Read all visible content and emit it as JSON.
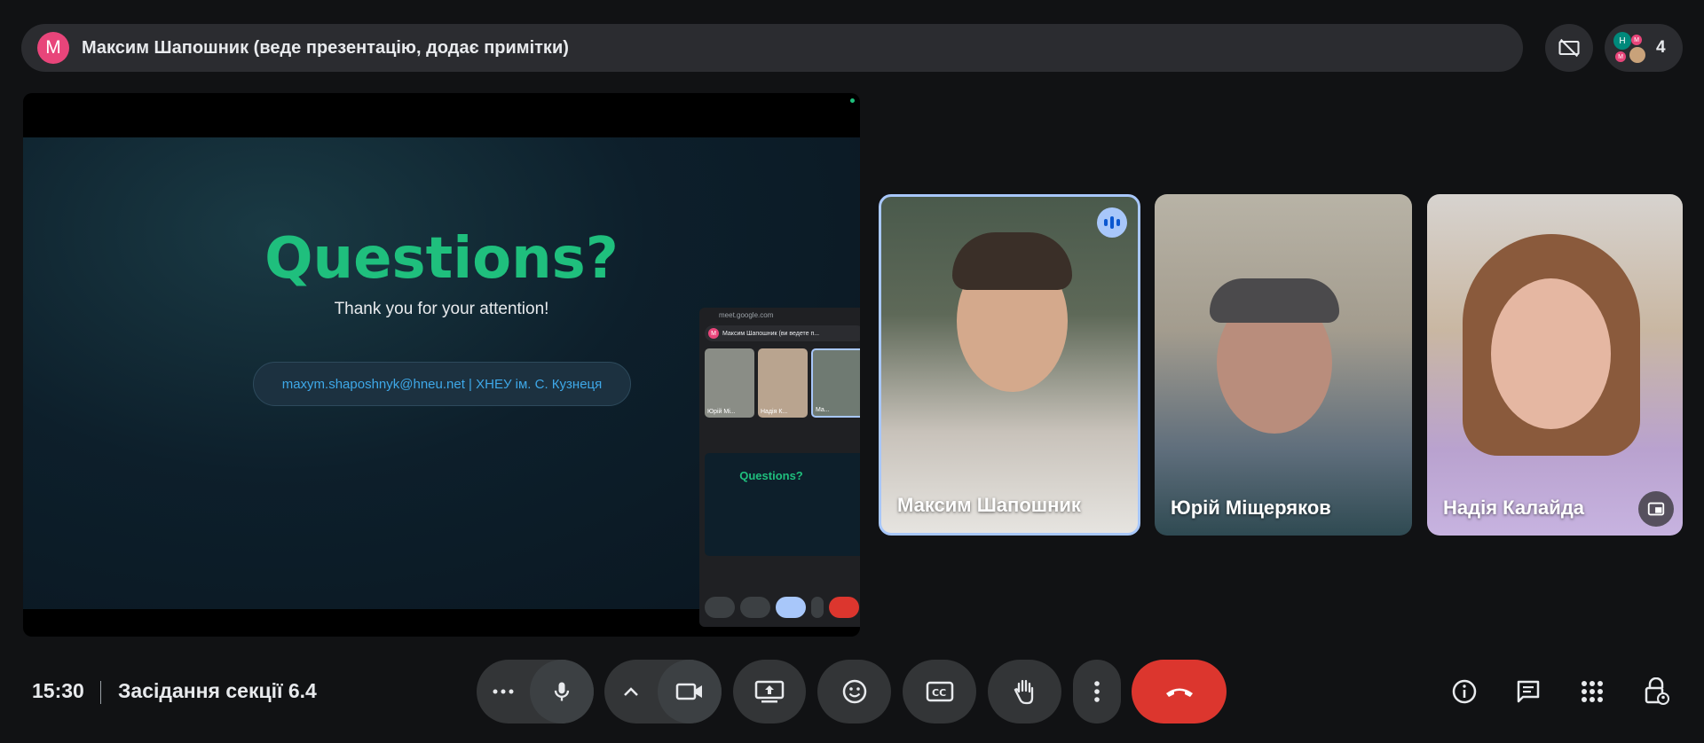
{
  "topbar": {
    "presenter_initial": "M",
    "presenter_title": "Максим Шапошник (веде презентацію, додає примітки)",
    "participant_count": "4",
    "mini_avatars": [
      "H",
      "M",
      "M"
    ]
  },
  "slide": {
    "title": "Questions?",
    "subtitle": "Thank you for your attention!",
    "contact": "maxym.shaposhnyk@hneu.net | ХНЕУ ім. С. Кузнеця"
  },
  "mini_window": {
    "url": "meet.google.com",
    "bar_initial": "M",
    "bar_text": "Максим Шапошник (ви ведете п...",
    "tiles": [
      "Юрій Мі...",
      "Надія К...",
      "Ма..."
    ],
    "shared_title": "Questions?"
  },
  "participants": [
    {
      "name": "Максим Шапошник",
      "speaking": true
    },
    {
      "name": "Юрій Міщеряков",
      "speaking": false
    },
    {
      "name": "Надія Калайда",
      "speaking": false
    }
  ],
  "bottom": {
    "time": "15:30",
    "meeting_name": "Засідання секції 6.4"
  },
  "colors": {
    "accent": "#a8c7fa",
    "end_call": "#dc362e",
    "slide_title": "#1fbf7d",
    "avatar": "#e8457a"
  }
}
